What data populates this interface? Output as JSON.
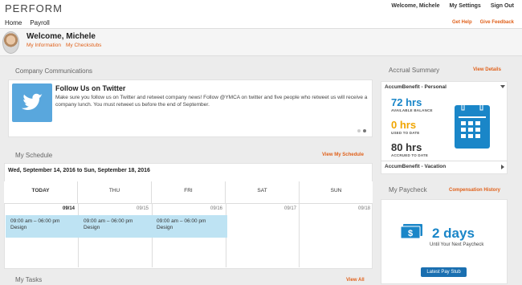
{
  "app": {
    "logo": "PERFORM"
  },
  "top_links": [
    "Welcome, Michele",
    "My Settings",
    "Sign Out"
  ],
  "nav": {
    "items": [
      "Home",
      "Payroll"
    ],
    "right": [
      "Get Help",
      "Give Feedback"
    ]
  },
  "welcome": {
    "title": "Welcome, Michele",
    "links": [
      "My Information",
      "My Checkstubs"
    ]
  },
  "communications": {
    "heading": "Company Communications",
    "post_title": "Follow Us on Twitter",
    "post_text": "Make sure you follow us on Twitter and retweet company news! Follow @YMCA on twitter and five people who retweet us will receive a company lunch. You must retweet us before the end of September."
  },
  "schedule": {
    "heading": "My Schedule",
    "link": "View My Schedule",
    "week": "Wed, September 14, 2016 to Sun, September 18, 2016",
    "days": [
      {
        "name": "TODAY",
        "date": "09/14"
      },
      {
        "name": "THU",
        "date": "09/15"
      },
      {
        "name": "FRI",
        "date": "09/16"
      },
      {
        "name": "SAT",
        "date": "09/17"
      },
      {
        "name": "SUN",
        "date": "09/18"
      }
    ],
    "shift_time": "09:00 am – 06:00 pm",
    "shift_role": "Design"
  },
  "tasks": {
    "heading": "My Tasks",
    "link": "View All"
  },
  "accrual": {
    "heading": "Accrual Summary",
    "link": "View Details",
    "benefit1": "AccumBenefit - Personal",
    "available_value": "72 hrs",
    "available_label": "AVAILABLE BALANCE",
    "used_value": "0 hrs",
    "used_label": "USED TO DATE",
    "accrued_value": "80 hrs",
    "accrued_label": "ACCRUED TO DATE",
    "benefit2": "AccumBenefit - Vacation"
  },
  "paycheck": {
    "heading": "My Paycheck",
    "link": "Compensation History",
    "days": "2 days",
    "subtitle": "Until Your Next Paycheck",
    "button": "Latest Pay Stub"
  },
  "colors": {
    "accent": "#e0611b",
    "blue": "#1a86c8",
    "highlight": "#bee3f3"
  }
}
